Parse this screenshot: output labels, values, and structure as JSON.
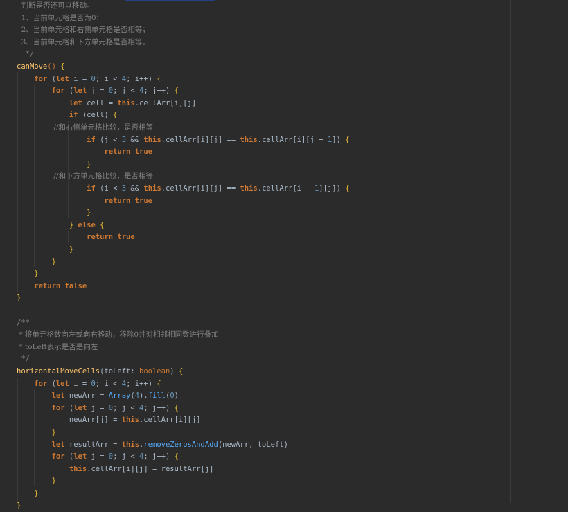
{
  "editor": {
    "lines": [
      [
        {
          "t": "  判断是否还可以移动。",
          "c": "comment"
        }
      ],
      [
        {
          "t": "  1、当前单元格是否为0；",
          "c": "comment"
        }
      ],
      [
        {
          "t": "  2、当前单元格和右侧单元格是否相等；",
          "c": "comment"
        }
      ],
      [
        {
          "t": "  3、当前单元格和下方单元格是否相等。",
          "c": "comment"
        }
      ],
      [
        {
          "t": "  */",
          "c": "comment"
        }
      ],
      [
        {
          "t": "canMove",
          "c": "func"
        },
        {
          "t": "() ",
          "c": "paren"
        },
        {
          "t": "{",
          "c": "brace"
        }
      ],
      [
        {
          "t": "    "
        },
        {
          "t": "for",
          "c": "keyword"
        },
        {
          "t": " ("
        },
        {
          "t": "let",
          "c": "keyword"
        },
        {
          "t": " i = "
        },
        {
          "t": "0",
          "c": "number"
        },
        {
          "t": "; i < "
        },
        {
          "t": "4",
          "c": "number"
        },
        {
          "t": "; i++) "
        },
        {
          "t": "{",
          "c": "brace"
        }
      ],
      [
        {
          "t": "        "
        },
        {
          "t": "for",
          "c": "keyword"
        },
        {
          "t": " ("
        },
        {
          "t": "let",
          "c": "keyword"
        },
        {
          "t": " j = "
        },
        {
          "t": "0",
          "c": "number"
        },
        {
          "t": "; j < "
        },
        {
          "t": "4",
          "c": "number"
        },
        {
          "t": "; j++) "
        },
        {
          "t": "{",
          "c": "brace"
        }
      ],
      [
        {
          "t": "            "
        },
        {
          "t": "let",
          "c": "keyword"
        },
        {
          "t": " cell = "
        },
        {
          "t": "this",
          "c": "keyword"
        },
        {
          "t": "."
        },
        {
          "t": "cellArr",
          "c": "plain"
        },
        {
          "t": "[i][j]"
        }
      ],
      [
        {
          "t": "            "
        },
        {
          "t": "if",
          "c": "keyword"
        },
        {
          "t": " (cell) "
        },
        {
          "t": "{",
          "c": "brace"
        }
      ],
      [
        {
          "t": "                //和右侧单元格比较，是否相等",
          "c": "comment"
        }
      ],
      [
        {
          "t": "                "
        },
        {
          "t": "if",
          "c": "keyword"
        },
        {
          "t": " (j < "
        },
        {
          "t": "3",
          "c": "number"
        },
        {
          "t": " && "
        },
        {
          "t": "this",
          "c": "keyword"
        },
        {
          "t": ".cellArr[i][j] == "
        },
        {
          "t": "this",
          "c": "keyword"
        },
        {
          "t": ".cellArr[i][j + "
        },
        {
          "t": "1",
          "c": "number"
        },
        {
          "t": "]) "
        },
        {
          "t": "{",
          "c": "brace"
        }
      ],
      [
        {
          "t": "                    "
        },
        {
          "t": "return true",
          "c": "keyword"
        }
      ],
      [
        {
          "t": "                "
        },
        {
          "t": "}",
          "c": "brace"
        }
      ],
      [
        {
          "t": "                //和下方单元格比较，是否相等",
          "c": "comment"
        }
      ],
      [
        {
          "t": "                "
        },
        {
          "t": "if",
          "c": "keyword"
        },
        {
          "t": " (i < "
        },
        {
          "t": "3",
          "c": "number"
        },
        {
          "t": " && "
        },
        {
          "t": "this",
          "c": "keyword"
        },
        {
          "t": ".cellArr[i][j] == "
        },
        {
          "t": "this",
          "c": "keyword"
        },
        {
          "t": ".cellArr[i + "
        },
        {
          "t": "1",
          "c": "number"
        },
        {
          "t": "][j]) "
        },
        {
          "t": "{",
          "c": "brace"
        }
      ],
      [
        {
          "t": "                    "
        },
        {
          "t": "return true",
          "c": "keyword"
        }
      ],
      [
        {
          "t": "                "
        },
        {
          "t": "}",
          "c": "brace"
        }
      ],
      [
        {
          "t": "            "
        },
        {
          "t": "}",
          "c": "brace"
        },
        {
          "t": " "
        },
        {
          "t": "else",
          "c": "keyword"
        },
        {
          "t": " "
        },
        {
          "t": "{",
          "c": "brace"
        }
      ],
      [
        {
          "t": "                "
        },
        {
          "t": "return true",
          "c": "keyword"
        }
      ],
      [
        {
          "t": "            "
        },
        {
          "t": "}",
          "c": "brace"
        }
      ],
      [
        {
          "t": "        "
        },
        {
          "t": "}",
          "c": "brace"
        }
      ],
      [
        {
          "t": "    "
        },
        {
          "t": "}",
          "c": "brace"
        }
      ],
      [
        {
          "t": "    "
        },
        {
          "t": "return false",
          "c": "keyword"
        }
      ],
      [
        {
          "t": "}",
          "c": "brace"
        }
      ],
      [
        {
          "t": ""
        }
      ],
      [
        {
          "t": "/**",
          "c": "comment"
        }
      ],
      [
        {
          "t": " * 将单元格数向左或向右移动，移除0并对相邻相同数进行叠加",
          "c": "comment"
        }
      ],
      [
        {
          "t": " * toLeft表示是否是向左",
          "c": "comment"
        }
      ],
      [
        {
          "t": " */",
          "c": "comment"
        }
      ],
      [
        {
          "t": "horizontalMoveCells",
          "c": "func"
        },
        {
          "t": "(toLeft: "
        },
        {
          "t": "boolean",
          "c": "type"
        },
        {
          "t": ") "
        },
        {
          "t": "{",
          "c": "brace"
        }
      ],
      [
        {
          "t": "    "
        },
        {
          "t": "for",
          "c": "keyword"
        },
        {
          "t": " ("
        },
        {
          "t": "let",
          "c": "keyword"
        },
        {
          "t": " i = "
        },
        {
          "t": "0",
          "c": "number"
        },
        {
          "t": "; i < "
        },
        {
          "t": "4",
          "c": "number"
        },
        {
          "t": "; i++) "
        },
        {
          "t": "{",
          "c": "brace"
        }
      ],
      [
        {
          "t": "        "
        },
        {
          "t": "let",
          "c": "keyword"
        },
        {
          "t": " newArr = "
        },
        {
          "t": "Array",
          "c": "method"
        },
        {
          "t": "("
        },
        {
          "t": "4",
          "c": "number"
        },
        {
          "t": ")."
        },
        {
          "t": "fill",
          "c": "method"
        },
        {
          "t": "("
        },
        {
          "t": "0",
          "c": "number"
        },
        {
          "t": ")"
        }
      ],
      [
        {
          "t": "        "
        },
        {
          "t": "for",
          "c": "keyword"
        },
        {
          "t": " ("
        },
        {
          "t": "let",
          "c": "keyword"
        },
        {
          "t": " j = "
        },
        {
          "t": "0",
          "c": "number"
        },
        {
          "t": "; j < "
        },
        {
          "t": "4",
          "c": "number"
        },
        {
          "t": "; j++) "
        },
        {
          "t": "{",
          "c": "brace"
        }
      ],
      [
        {
          "t": "            newArr[j] = "
        },
        {
          "t": "this",
          "c": "keyword"
        },
        {
          "t": ".cellArr[i][j]"
        }
      ],
      [
        {
          "t": "        "
        },
        {
          "t": "}",
          "c": "brace"
        }
      ],
      [
        {
          "t": "        "
        },
        {
          "t": "let",
          "c": "keyword"
        },
        {
          "t": " resultArr = "
        },
        {
          "t": "this",
          "c": "keyword"
        },
        {
          "t": "."
        },
        {
          "t": "removeZerosAndAdd",
          "c": "method"
        },
        {
          "t": "(newArr, toLeft)"
        }
      ],
      [
        {
          "t": "        "
        },
        {
          "t": "for",
          "c": "keyword"
        },
        {
          "t": " ("
        },
        {
          "t": "let",
          "c": "keyword"
        },
        {
          "t": " j = "
        },
        {
          "t": "0",
          "c": "number"
        },
        {
          "t": "; j < "
        },
        {
          "t": "4",
          "c": "number"
        },
        {
          "t": "; j++) "
        },
        {
          "t": "{",
          "c": "brace"
        }
      ],
      [
        {
          "t": "            "
        },
        {
          "t": "this",
          "c": "keyword"
        },
        {
          "t": ".cellArr[i][j] = resultArr[j]"
        }
      ],
      [
        {
          "t": "        "
        },
        {
          "t": "}",
          "c": "brace"
        }
      ],
      [
        {
          "t": "    "
        },
        {
          "t": "}",
          "c": "brace"
        }
      ],
      [
        {
          "t": "}",
          "c": "brace"
        }
      ]
    ]
  }
}
